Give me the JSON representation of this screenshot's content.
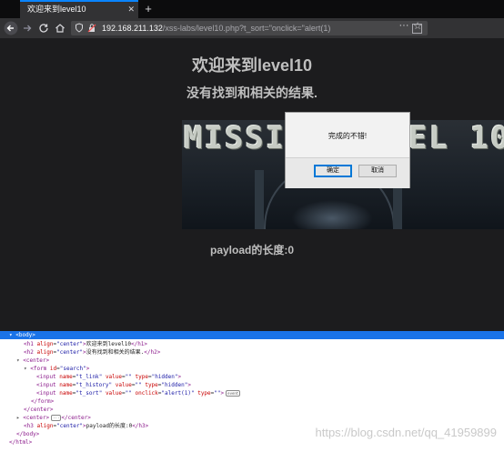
{
  "browser": {
    "tab_title": "欢迎来到level10",
    "tab_close": "✕",
    "new_tab": "+",
    "url_host": "192.168.211.132",
    "url_path": "/xss-labs/level10.php?t_sort=\"onclick=\"alert(1)",
    "more": "···",
    "bookmark": "☆"
  },
  "page": {
    "heading": "欢迎来到level10",
    "subheading": "没有找到和相关的结果.",
    "banner_text": "MISSION LEVEL 10",
    "payload_line": "payload的长度:0"
  },
  "dialog": {
    "message": "完成的不错!",
    "ok_label": "确定",
    "cancel_label": "取消"
  },
  "devtools": {
    "lines": {
      "body_open": "<body>",
      "h1_text": "欢迎来到level10",
      "h2_text": "没有找到和相关的结果.",
      "center_open": "<center>",
      "form_id": "search",
      "input1_name": "t_link",
      "input1_value": "",
      "input1_type": "hidden",
      "input2_name": "t_history",
      "input2_value": "",
      "input2_type": "hidden",
      "input3_name": "t_sort",
      "input3_value": "",
      "input3_onclick": "alert(1)",
      "input3_type": "",
      "event_badge": "event",
      "form_close": "</form>",
      "center_close": "</center>",
      "center2": "<center>",
      "center2_ellipsis": "···",
      "center2_close": "</center>",
      "h3_text": "payload的长度:0",
      "body_close": "</body>",
      "html_close": "</html>"
    }
  },
  "watermark": "https://blog.csdn.net/qq_41959899"
}
